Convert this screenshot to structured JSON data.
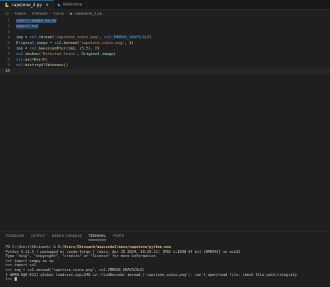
{
  "tabs": [
    {
      "icon": "python-icon",
      "label": "capstone_2.py",
      "active": true
    },
    {
      "icon": "vscode-icon",
      "label": "Welcome",
      "active": false
    }
  ],
  "breadcrumbs": [
    "C:",
    "Users",
    "Chrisant",
    "Coins",
    "capstone_2.py"
  ],
  "code": {
    "line_numbers": [
      "1",
      "2",
      "3",
      "4",
      "5",
      "6",
      "7",
      "8",
      "9",
      "10"
    ],
    "line1_kw": "import",
    "line1_rest": " numpy as np",
    "line2_kw": "import",
    "line2_rest": " cv2",
    "line4": {
      "v": "img",
      "eq": " = ",
      "mod": "cv2",
      "dot": ".",
      "fn": "imread",
      "po": "(",
      "s": "'capstone_coins.png'",
      "c": ", ",
      "mod2": "cv2",
      "dot2": ".",
      "k": "IMREAD_GRAYSCALE",
      "pc": ")"
    },
    "line5": {
      "v": "Original_image",
      "eq": " = ",
      "mod": "cv2",
      "dot": ".",
      "fn": "imread",
      "po": "(",
      "s": "'capstone_coins.png'",
      "c": ", ",
      "n": "1",
      "pc": ")"
    },
    "line6": {
      "v": "img",
      "eq": " = ",
      "mod": "cv2",
      "dot": ".",
      "fn": "GaussianBlur",
      "po": "(",
      "a": "img",
      "c": ", ",
      "t1": "(",
      "n1": "5",
      "c2": ",",
      "n2": "5",
      "t2": ")",
      "c3": ", ",
      "n3": "0",
      "pc": ")"
    },
    "line7": {
      "mod": "cv2",
      "dot": ".",
      "fn": "imshow",
      "po": "(",
      "s": "'Detected Coins'",
      "c": ", ",
      "a": "Original_image",
      "pc": ")"
    },
    "line8": {
      "mod": "cv2",
      "dot": ".",
      "fn": "waitKey",
      "po": "(",
      "n": "0",
      "pc": ")"
    },
    "line9": {
      "mod": "cv2",
      "dot": ".",
      "fn": "destroyAllWindows",
      "po": "(",
      "pc": ")"
    }
  },
  "panel_tabs": [
    "PROBLEMS",
    "OUTPUT",
    "DEBUG CONSOLE",
    "TERMINAL",
    "PORTS"
  ],
  "active_panel_tab": "TERMINAL",
  "terminal": {
    "prompt_prefix": "PS C:\\Users\\Chrisant> & ",
    "prompt_path": "C:/Users/Chrisant/anaconda3/envs/capstone/python.exe",
    "lines": [
      "Python 3.12.3 | packaged by conda-forge | (main, Apr 15 2024, 18:20:11) [MSC v.1938 64 bit (AMD64)] on win32",
      "Type \"help\", \"copyright\", \"credits\" or \"license\" for more information.",
      ">>> import numpy as np",
      ">>> import cv2",
      ">>> img = cv2.imread('capstone_coins.png', cv2.IMREAD_GRAYSCALE)",
      "[ WARN:0@0.011] global loadsave.cpp:248 cv::findDecoder imread_('capstone_coins.png'): can't open/read file: check file path/integrity"
    ],
    "final_prompt": ">>> "
  },
  "colors": {
    "accent": "#0078d4",
    "keyword": "#c586c0",
    "string": "#ce9178",
    "function": "#dcdcaa",
    "variable": "#9cdcfe",
    "number": "#b5cea8"
  }
}
